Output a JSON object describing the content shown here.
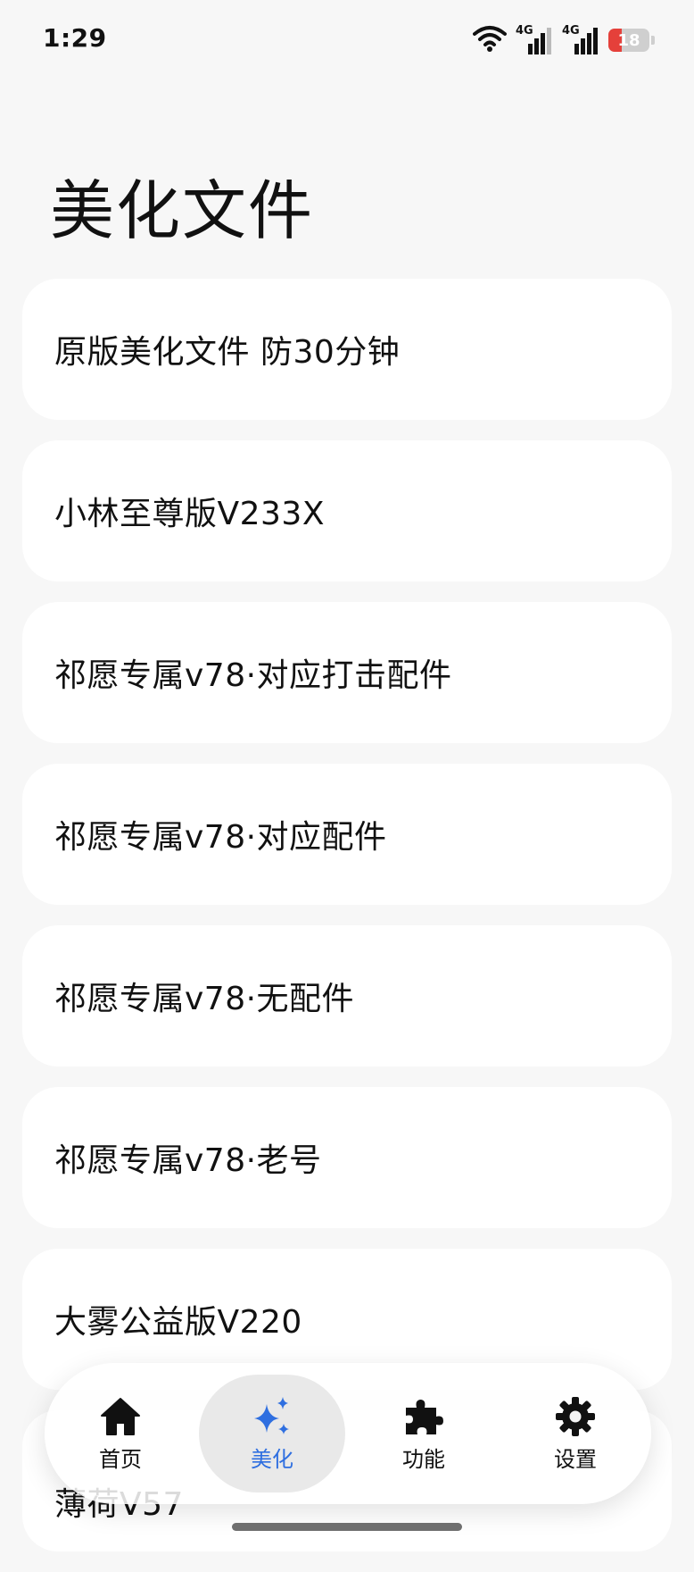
{
  "status_bar": {
    "time": "1:29",
    "signal_1_type": "4G",
    "signal_2_type": "4G",
    "battery_level": "18",
    "battery_color": "#e5403a"
  },
  "page": {
    "title": "美化文件"
  },
  "items": [
    {
      "label": "原版美化文件 防30分钟"
    },
    {
      "label": "小林至尊版V233X"
    },
    {
      "label": "祁愿专属v78·对应打击配件"
    },
    {
      "label": "祁愿专属v78·对应配件"
    },
    {
      "label": "祁愿专属v78·无配件"
    },
    {
      "label": "祁愿专属v78·老号"
    },
    {
      "label": "大雾公益版V220"
    },
    {
      "label": "薄荷V57"
    }
  ],
  "bottom_nav": {
    "accent_color": "#2f6fe0",
    "items": [
      {
        "label": "首页",
        "icon": "home-icon",
        "active": false
      },
      {
        "label": "美化",
        "icon": "sparkle-icon",
        "active": true
      },
      {
        "label": "功能",
        "icon": "puzzle-icon",
        "active": false
      },
      {
        "label": "设置",
        "icon": "gear-icon",
        "active": false
      }
    ]
  }
}
